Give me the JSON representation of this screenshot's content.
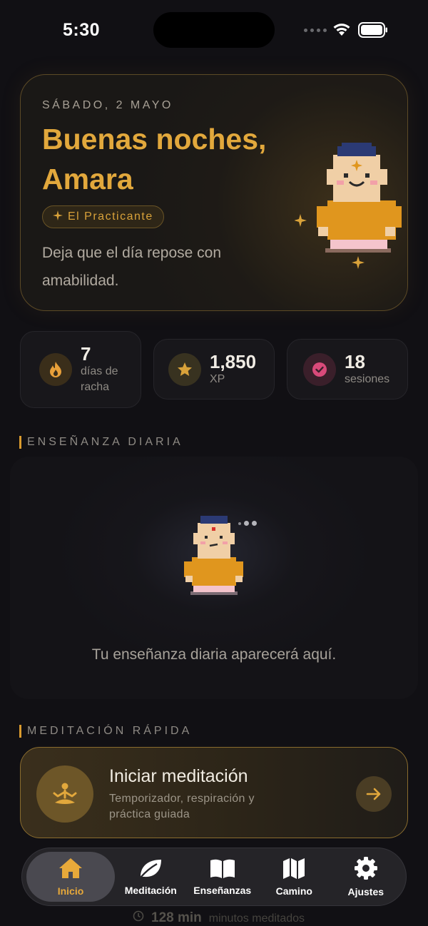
{
  "status_bar": {
    "time": "5:30"
  },
  "greeting_card": {
    "date": "SÁBADO, 2 MAYO",
    "greeting": "Buenas noches, Amara",
    "rank": "El Practicante",
    "tagline": "Deja que el día repose con amabilidad."
  },
  "stats": [
    {
      "value": "7",
      "label": "días de racha",
      "icon": "flame-icon",
      "color": "#e8a03a"
    },
    {
      "value": "1,850",
      "label": "XP",
      "icon": "star-icon",
      "color": "#d9a23a"
    },
    {
      "value": "18",
      "label": "sesiones",
      "icon": "check-circle-icon",
      "color": "#d94a7a"
    }
  ],
  "daily_teaching": {
    "heading": "ENSEÑANZA DIARIA",
    "placeholder": "Tu enseñanza diaria aparecerá aquí."
  },
  "quick_meditation": {
    "heading": "MEDITACIÓN RÁPIDA",
    "title": "Iniciar meditación",
    "subtitle": "Temporizador, respiración y práctica guiada"
  },
  "background_peek": {
    "value": "128 min",
    "label": "minutos meditados"
  },
  "tab_bar": {
    "active": "Inicio",
    "items": [
      {
        "label": "Inicio",
        "icon": "home-icon"
      },
      {
        "label": "Meditación",
        "icon": "leaf-icon"
      },
      {
        "label": "Enseñanzas",
        "icon": "book-icon"
      },
      {
        "label": "Camino",
        "icon": "map-icon"
      },
      {
        "label": "Ajustes",
        "icon": "gear-icon"
      }
    ]
  },
  "colors": {
    "accent": "#e2a83c",
    "background": "#111014",
    "card": "#1a1816"
  }
}
